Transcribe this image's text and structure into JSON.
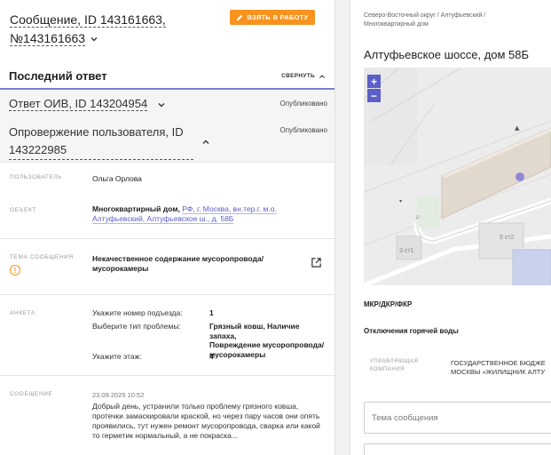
{
  "message": {
    "title": "Сообщение, ID 143161663,",
    "number": "№143161663",
    "take_button": "ВЗЯТЬ В РАБОТУ"
  },
  "last_response": {
    "label": "Последний ответ",
    "collapse": "СВЕРНУТЬ"
  },
  "responses": [
    {
      "title": "Ответ ОИВ, ID 143204954",
      "status": "Опубликовано"
    },
    {
      "title_line1": "Опровержение пользователя, ID",
      "title_line2": "143222985",
      "status": "Опубликовано"
    }
  ],
  "fields": {
    "user": {
      "label": "ПОЛЬЗОВАТЕЛЬ",
      "value": "Ольга Орлова"
    },
    "object": {
      "label": "ОБЪЕКТ",
      "bold": "Многоквартирный дом,",
      "link1": "РФ, г. Москва, вн.тер.г. м.о.",
      "link2": "Алтуфьевский, Алтуфьевское ш., д. 58Б"
    },
    "topic": {
      "label": "ТЕМА СООБЩЕНИЯ",
      "value_line1": "Некачественное содержание мусоропровода/",
      "value_line2": "мусорокамеры"
    },
    "survey": {
      "label": "АНКЕТА",
      "rows": [
        {
          "q": "Укажите номер подъезда:",
          "a1": "1",
          "a2": "",
          "a3": ""
        },
        {
          "q": "Выберите тип проблемы:",
          "a1": "Грязный ковш, Наличие запаха,",
          "a2": "Повреждение мусоропровода/",
          "a3": "мусорокамеры"
        },
        {
          "q": "Укажите этаж:",
          "a1": "4",
          "a2": "",
          "a3": ""
        }
      ]
    },
    "message": {
      "label": "СООБЩЕНИЕ",
      "date": "23.09.2025 10:52",
      "lines": [
        "Добрый день, устранили только проблему грязного ковша,",
        "протечки замаскировали краской, но через пару часов они опять",
        "проявились, тут нужен ремонт мусоропровода, сварка или какой",
        "то герметик нормальный, а не покраска..."
      ]
    }
  },
  "right": {
    "breadcrumb_line1": "Северо-Восточный округ / Алтуфьевский /",
    "breadcrumb_line2": "Многоквартирный дом",
    "address": "Алтуфьевское шоссе, дом 58Б",
    "map": {
      "zoom_in": "+",
      "zoom_out": "−",
      "labels": [
        "3 ст1",
        "5 ст2",
        "P"
      ]
    },
    "category": "МКР/ДКР/ФКР",
    "subcategory": "Отключения горячей воды",
    "org_label_line1": "УПРАВЛЯЮЩАЯ",
    "org_label_line2": "КОМПАНИЯ",
    "org_line1": "ГОСУДАРСТВЕННОЕ БЮДЖЕ",
    "org_line2": "МОСКВЫ «ЖИЛИЩНИК АЛТУ",
    "subject_placeholder": "Тема сообщения"
  },
  "colors": {
    "accent": "#5b5fc7",
    "orange": "#f7931e",
    "panel_bg": "#f5f5f5"
  }
}
